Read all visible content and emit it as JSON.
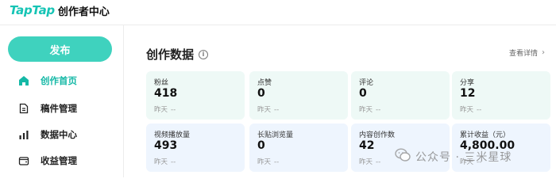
{
  "header": {
    "logo_word": "TapTap",
    "logo_sub": "创作者中心"
  },
  "sidebar": {
    "publish_label": "发布",
    "items": [
      {
        "label": "创作首页",
        "icon": "home-icon",
        "active": true
      },
      {
        "label": "稿件管理",
        "icon": "document-icon",
        "active": false
      },
      {
        "label": "数据中心",
        "icon": "bar-chart-icon",
        "active": false
      },
      {
        "label": "收益管理",
        "icon": "wallet-icon",
        "active": false
      }
    ]
  },
  "main": {
    "title": "创作数据",
    "info_icon": "ⓘ",
    "detail_link": "查看详情",
    "cards": [
      {
        "label": "粉丝",
        "value": "418",
        "foot_label": "昨天",
        "foot_value": "--"
      },
      {
        "label": "点赞",
        "value": "0",
        "foot_label": "昨天",
        "foot_value": "--"
      },
      {
        "label": "评论",
        "value": "0",
        "foot_label": "昨天",
        "foot_value": "--"
      },
      {
        "label": "分享",
        "value": "12",
        "foot_label": "昨天",
        "foot_value": "--"
      },
      {
        "label": "视频播放量",
        "value": "493",
        "foot_label": "昨天",
        "foot_value": "--"
      },
      {
        "label": "长贴浏览量",
        "value": "0",
        "foot_label": "昨天",
        "foot_value": "--"
      },
      {
        "label": "内容创作数",
        "value": "42",
        "foot_label": "昨天",
        "foot_value": "--"
      },
      {
        "label": "累计收益（元）",
        "value": "4,800.00",
        "foot_label": "昨天",
        "foot_value": "--"
      }
    ]
  },
  "watermark": {
    "text": "公众号 · 三米星球"
  },
  "colors": {
    "brand": "#16c4b5",
    "publish_button": "#3fd2be",
    "active_nav": "#14b8a6",
    "card_mint": "#eef9f6",
    "card_blue": "#eef5fe"
  }
}
